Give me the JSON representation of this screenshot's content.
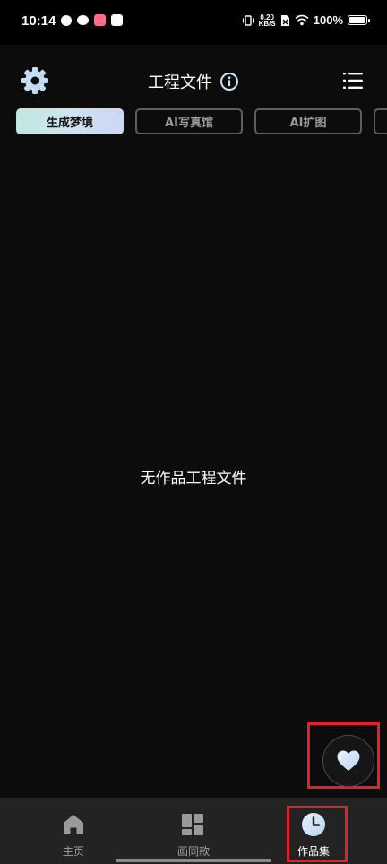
{
  "status_bar": {
    "time": "10:14",
    "net_speed_value": "0.20",
    "net_speed_unit": "KB/S",
    "battery": "100%"
  },
  "header": {
    "title": "工程文件"
  },
  "tabs": [
    {
      "label": "生成梦境",
      "active": true
    },
    {
      "label": "AI写真馆",
      "active": false
    },
    {
      "label": "AI扩图",
      "active": false
    },
    {
      "label": "",
      "active": false
    }
  ],
  "main": {
    "empty_message": "无作品工程文件"
  },
  "bottom_nav": {
    "items": [
      {
        "label": "主页",
        "icon": "home-icon",
        "active": false
      },
      {
        "label": "画同款",
        "icon": "grid-icon",
        "active": false
      },
      {
        "label": "作品集",
        "icon": "clock-icon",
        "active": true
      }
    ]
  },
  "colors": {
    "highlight": "#e5202a",
    "active_tab_gradient_start": "#bfe8df",
    "active_tab_gradient_end": "#cdd6f6",
    "accent_light_blue": "#cfe2f7"
  }
}
